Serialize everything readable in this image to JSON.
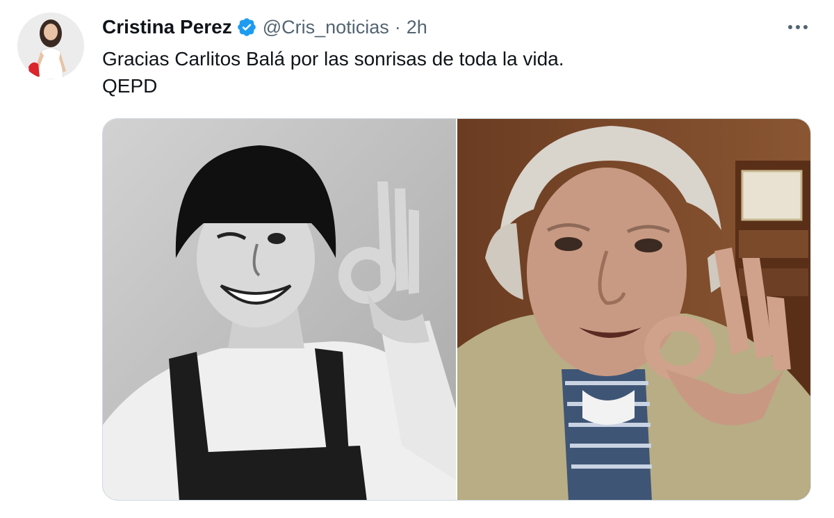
{
  "tweet": {
    "author": {
      "display_name": "Cristina Perez",
      "handle": "@Cris_noticias",
      "verified": true,
      "avatar_icon": "profile-photo"
    },
    "separator": "·",
    "timestamp": "2h",
    "more_icon": "more-horizontal-icon",
    "text_lines": [
      "Gracias Carlitos Balá por las sonrisas de toda la vida.",
      "QEPD"
    ],
    "media": [
      {
        "description_icon": "photo-black-and-white"
      },
      {
        "description_icon": "photo-color"
      }
    ]
  },
  "colors": {
    "text_primary": "#0f1419",
    "text_secondary": "#536471",
    "verified_blue": "#1d9bf0",
    "border": "#cfd9de"
  }
}
